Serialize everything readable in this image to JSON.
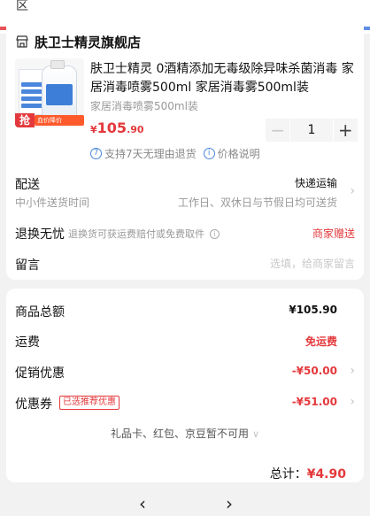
{
  "top": {
    "address_tail": "区"
  },
  "shop": {
    "name": "肤卫士精灵旗舰店",
    "icon": "store-icon"
  },
  "product": {
    "title": "肤卫士精灵 0酒精添加无毒级除异味杀菌消毒 家居消毒喷雾500ml 家居消毒雾500ml装",
    "sku": "家居消毒喷雾500ml装",
    "price_symbol": "¥",
    "price_int": "105",
    "price_dec": ".90",
    "quantity": "1",
    "minus_label": "−",
    "plus_label": "+",
    "thumb_badge": "抢",
    "thumb_sale": "血价降价30.00%"
  },
  "service": {
    "return_icon": "7",
    "return_text": "支持7天无理由退货",
    "price_icon": "i",
    "price_text": "价格说明"
  },
  "delivery": {
    "label": "配送",
    "sub": "中小件送货时间",
    "value": "快递运输",
    "time": "工作日、双休日与节假日均可送货"
  },
  "returns": {
    "label": "退换无忧",
    "desc": "退换货可获运费赔付或免费取件",
    "value": "商家赠送"
  },
  "note": {
    "label": "留言",
    "placeholder": "选填，给商家留言"
  },
  "summary": {
    "goods_label": "商品总额",
    "goods_value": "¥105.90",
    "shipping_label": "运费",
    "shipping_value": "免运费",
    "promo_label": "促销优惠",
    "promo_value": "-¥50.00",
    "coupon_label": "优惠券",
    "coupon_tag": "已选推荐优惠",
    "coupon_value": "-¥51.00",
    "gift_text": "礼品卡、红包、京豆暂不可用",
    "total_label": "总计：",
    "total_value": "¥4.90"
  },
  "nav": {
    "back": "‹",
    "forward": "›"
  },
  "colors": {
    "accent": "#e4393c",
    "link": "#4a86dc",
    "bg": "#f2f2f2"
  }
}
